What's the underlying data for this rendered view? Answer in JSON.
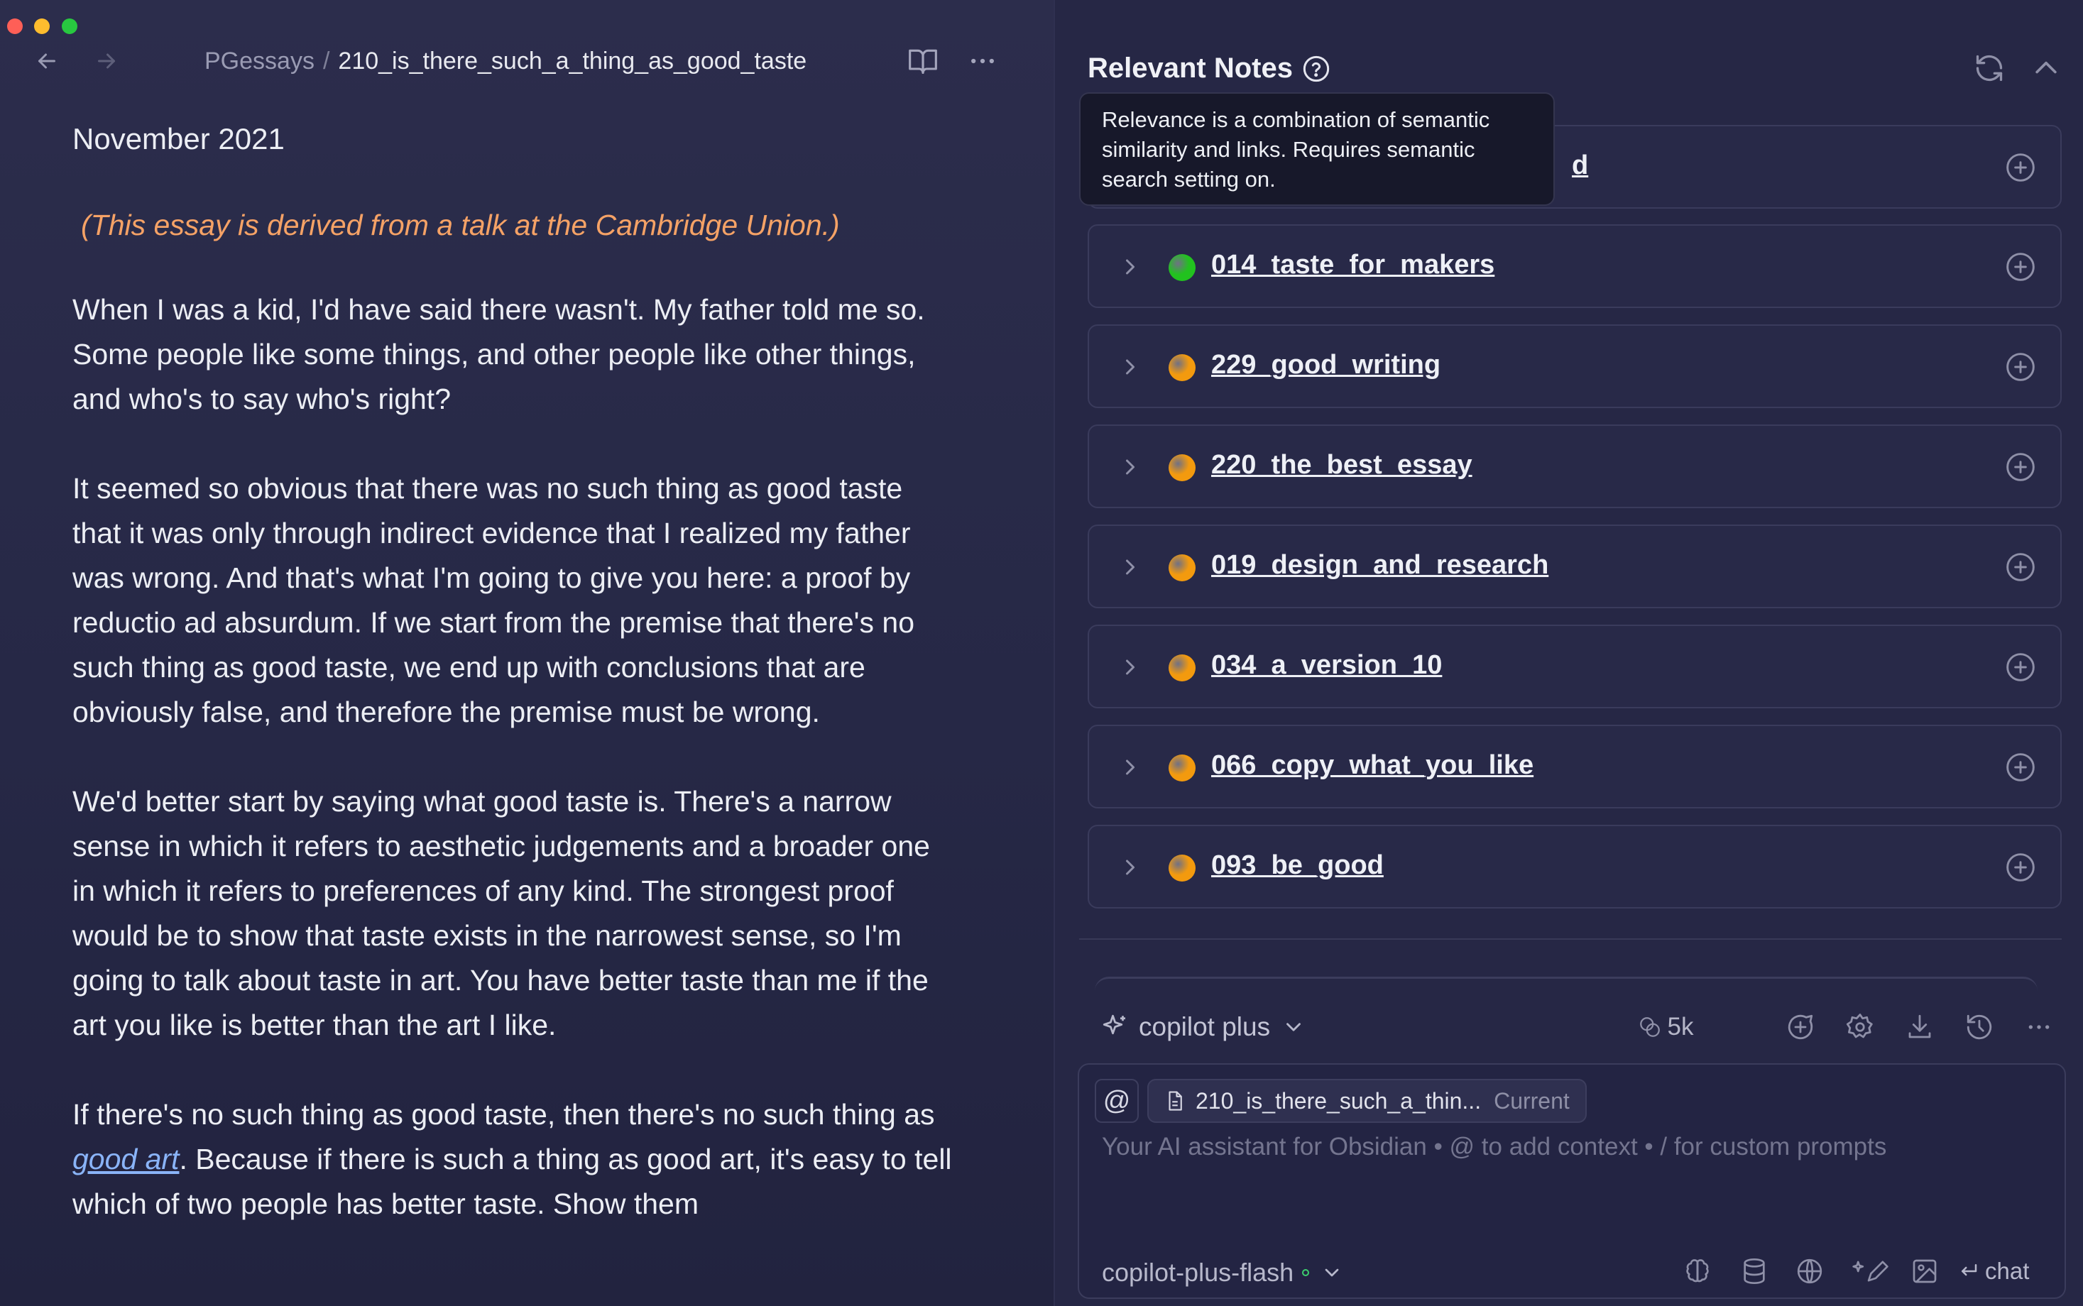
{
  "window": {
    "traffic_lights": {
      "close": "#fe5f57",
      "minimize": "#febc2e",
      "maximize": "#28c840"
    }
  },
  "editor": {
    "breadcrumb": {
      "parent": "PGessays",
      "separator": "/",
      "current": "210_is_there_such_a_thing_as_good_taste"
    },
    "icons": [
      "arrow-left-icon",
      "arrow-right-icon",
      "book-open-icon",
      "more-horizontal-icon"
    ],
    "content": {
      "date": "November 2021",
      "italic_note": "(This essay is derived from a talk at the Cambridge Union.)",
      "paragraphs": [
        "When I was a kid, I'd have said there wasn't. My father told me so. Some people like some things, and other people like other things, and who's to say who's right?",
        "It seemed so obvious that there was no such thing as good taste that it was only through indirect evidence that I realized my father was wrong. And that's what I'm going to give you here: a proof by reductio ad absurdum. If we start from the premise that there's no such thing as good taste, we end up with conclusions that are obviously false, and therefore the premise must be wrong.",
        "We'd better start by saying what good taste is. There's a narrow sense in which it refers to aesthetic judgements and a broader one in which it refers to preferences of any kind. The strongest proof would be to show that taste exists in the narrowest sense, so I'm going to talk about taste in art. You have better taste than me if the art you like is better than the art I like."
      ],
      "last_paragraph": {
        "before_link": "If there's no such thing as good taste, then there's no such thing as ",
        "link_text": "good art",
        "after_link": ". Because if there is such a thing as good art, it's easy to tell which of two people has better taste. Show them"
      }
    }
  },
  "copilot": {
    "relevant_notes": {
      "title": "Relevant Notes",
      "tooltip": "Relevance is a combination of semantic similarity and links. Requires semantic search setting on.",
      "hidden_first_item_tail": "d",
      "items": [
        {
          "title": "014_taste_for_makers",
          "dot_color": "#22c21f"
        },
        {
          "title": "229_good_writing",
          "dot_color": "#f39a0e"
        },
        {
          "title": "220_the_best_essay",
          "dot_color": "#f39a0e"
        },
        {
          "title": "019_design_and_research",
          "dot_color": "#f39a0e"
        },
        {
          "title": "034_a_version_10",
          "dot_color": "#f39a0e"
        },
        {
          "title": "066_copy_what_you_like",
          "dot_color": "#f39a0e"
        },
        {
          "title": "093_be_good",
          "dot_color": "#f39a0e"
        }
      ]
    },
    "chat": {
      "mode": "copilot plus",
      "token_count": "5k",
      "at_symbol": "@",
      "context_file": "210_is_there_such_a_thin...",
      "context_tag": "Current",
      "placeholder": "Your AI assistant for Obsidian • @ to add context • / for custom prompts",
      "model": "copilot-plus-flash",
      "send_label": "chat"
    }
  }
}
